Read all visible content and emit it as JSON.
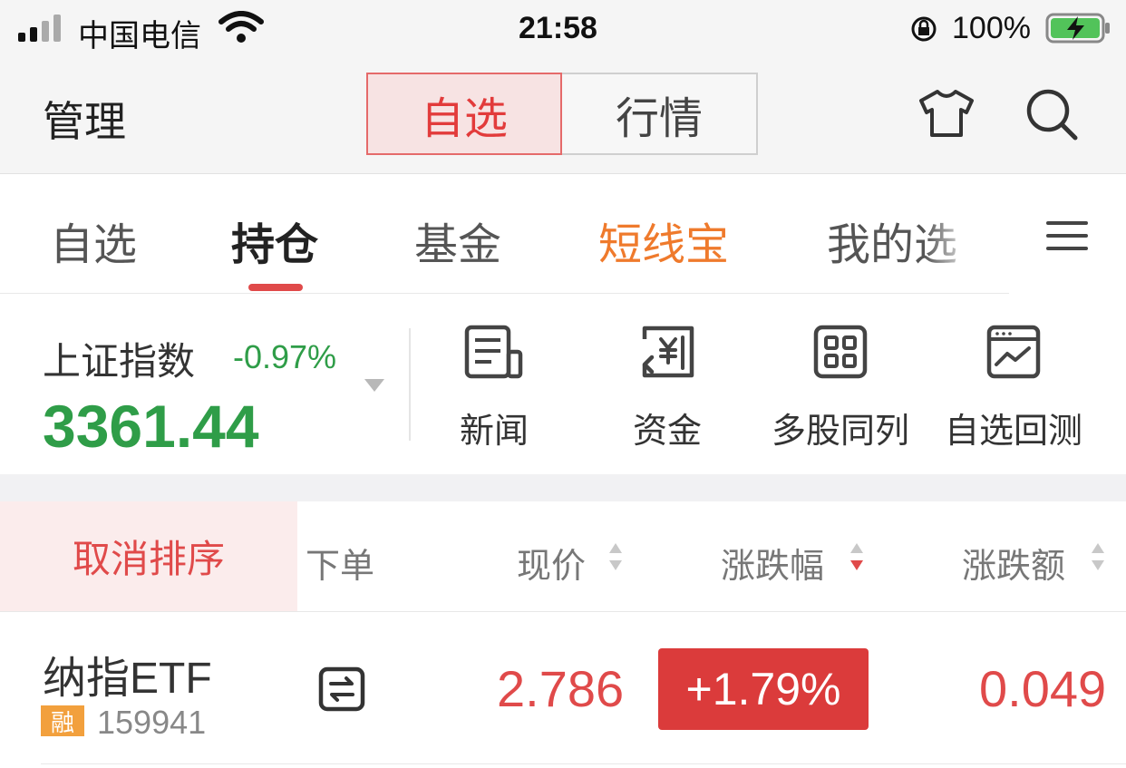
{
  "status_bar": {
    "carrier": "中国电信",
    "time": "21:58",
    "battery": "100%"
  },
  "nav": {
    "manage_label": "管理",
    "seg_selected": "自选",
    "seg_other": "行情",
    "icons": [
      "shirt-icon",
      "search-icon"
    ]
  },
  "tabs": [
    {
      "label": "自选",
      "state": "normal"
    },
    {
      "label": "持仓",
      "state": "active"
    },
    {
      "label": "基金",
      "state": "normal"
    },
    {
      "label": "短线宝",
      "state": "highlight"
    },
    {
      "label": "我的选",
      "state": "faded"
    }
  ],
  "index": {
    "name": "上证指数",
    "change_pct": "-0.97%",
    "value": "3361.44"
  },
  "tools": [
    {
      "label": "新闻",
      "icon": "news-icon"
    },
    {
      "label": "资金",
      "icon": "funds-icon"
    },
    {
      "label": "多股同列",
      "icon": "grid-icon"
    },
    {
      "label": "自选回测",
      "icon": "backtest-icon"
    }
  ],
  "table": {
    "cancel_sort_label": "取消排序",
    "columns": [
      "下单",
      "现价",
      "涨跌幅",
      "涨跌额"
    ],
    "rows": [
      {
        "name": "纳指ETF",
        "badge": "融",
        "code": "159941",
        "price": "2.786",
        "change_pct": "+1.79%",
        "change_amt": "0.049"
      }
    ]
  },
  "colors": {
    "up_red": "#e04a4a",
    "down_green": "#2f9d48",
    "orange": "#ef7a2c"
  }
}
